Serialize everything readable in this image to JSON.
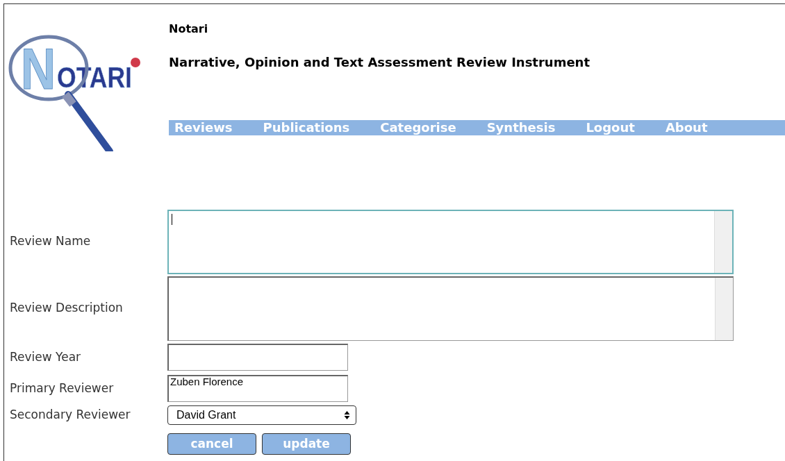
{
  "logo": {
    "text": "NOTARI"
  },
  "header": {
    "title": "Notari",
    "subtitle": "Narrative, Opinion and Text Assessment Review Instrument"
  },
  "nav": [
    {
      "label": "Reviews"
    },
    {
      "label": "Publications"
    },
    {
      "label": "Categorise"
    },
    {
      "label": "Synthesis"
    },
    {
      "label": "Logout"
    },
    {
      "label": "About"
    }
  ],
  "form": {
    "fields": [
      {
        "kind": "textarea",
        "label": "Review Name",
        "focused": true
      },
      {
        "kind": "textarea",
        "label": "Review Description",
        "focused": false
      },
      {
        "kind": "text",
        "label": "Review Year",
        "focused": false
      },
      {
        "kind": "text",
        "label": "Primary Reviewer",
        "value": "Zuben Florence",
        "focused": false
      },
      {
        "kind": "select",
        "label": "Secondary Reviewer",
        "value": "David Grant",
        "focused": false
      }
    ],
    "buttons": [
      "cancel",
      "update"
    ]
  }
}
